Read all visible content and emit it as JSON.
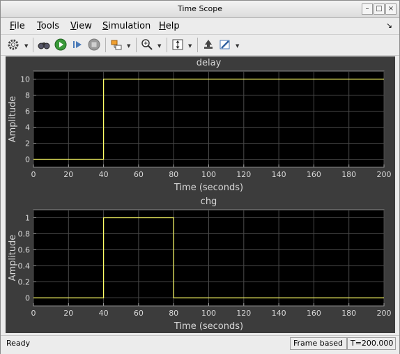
{
  "window": {
    "title": "Time Scope"
  },
  "menu": [
    {
      "label": "File",
      "mnemonic": "F",
      "rest": "ile"
    },
    {
      "label": "Tools",
      "mnemonic": "T",
      "rest": "ools"
    },
    {
      "label": "View",
      "mnemonic": "V",
      "rest": "iew"
    },
    {
      "label": "Simulation",
      "mnemonic": "S",
      "rest": "imulation"
    },
    {
      "label": "Help",
      "mnemonic": "H",
      "rest": "elp"
    }
  ],
  "toolbar": {
    "icons": [
      "gear-icon",
      "binoculars-icon",
      "run-icon",
      "step-forward-icon",
      "stop-icon",
      "signal-select-icon",
      "zoom-in-icon",
      "scale-axes-icon",
      "highlight-icon",
      "style-icon"
    ]
  },
  "colors": {
    "plot_bg": "#000000",
    "frame_bg": "#3c3c3c",
    "trace": "#ffff66",
    "grid": "#4a4a4a",
    "text": "#d8d8d8"
  },
  "chart_data": [
    {
      "type": "line",
      "title": "delay",
      "xlabel": "Time (seconds)",
      "ylabel": "Amplitude",
      "xlim": [
        0,
        200
      ],
      "ylim": [
        -1,
        11
      ],
      "xticks": [
        0,
        20,
        40,
        60,
        80,
        100,
        120,
        140,
        160,
        180,
        200
      ],
      "yticks": [
        0,
        2,
        4,
        6,
        8,
        10
      ],
      "ytick_labels": [
        "0",
        "2",
        "4",
        "6",
        "8",
        "10"
      ],
      "grid": true,
      "series": [
        {
          "x": [
            0,
            40,
            40,
            200
          ],
          "y": [
            0,
            0,
            10,
            10
          ]
        }
      ]
    },
    {
      "type": "line",
      "title": "chg",
      "xlabel": "Time (seconds)",
      "ylabel": "Amplitude",
      "xlim": [
        0,
        200
      ],
      "ylim": [
        -0.1,
        1.1
      ],
      "xticks": [
        0,
        20,
        40,
        60,
        80,
        100,
        120,
        140,
        160,
        180,
        200
      ],
      "yticks": [
        0,
        0.2,
        0.4,
        0.6,
        0.8,
        1
      ],
      "ytick_labels": [
        "0",
        "0.2",
        "0.4",
        "0.6",
        "0.8",
        "1"
      ],
      "grid": true,
      "series": [
        {
          "x": [
            0,
            40,
            40,
            80,
            80,
            200
          ],
          "y": [
            0,
            0,
            1,
            1,
            0,
            0
          ]
        }
      ]
    }
  ],
  "status": {
    "text": "Ready",
    "mode": "Frame based",
    "time": "T=200.000"
  }
}
